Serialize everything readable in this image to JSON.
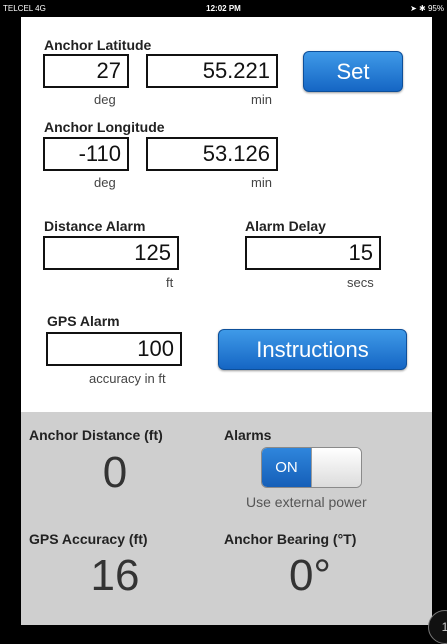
{
  "status_bar": {
    "carrier": "TELCEL  4G",
    "time": "12:02 PM",
    "battery": "95%"
  },
  "anchor_latitude": {
    "label": "Anchor Latitude",
    "degrees": "27",
    "minutes": "55.221",
    "deg_unit": "deg",
    "min_unit": "min"
  },
  "anchor_longitude": {
    "label": "Anchor Longitude",
    "degrees": "-110",
    "minutes": "53.126",
    "deg_unit": "deg",
    "min_unit": "min"
  },
  "set_button": {
    "label": "Set"
  },
  "distance_alarm": {
    "label": "Distance Alarm",
    "value": "125",
    "unit": "ft"
  },
  "alarm_delay": {
    "label": "Alarm Delay",
    "value": "15",
    "unit": "secs"
  },
  "gps_alarm": {
    "label": "GPS Alarm",
    "value": "100",
    "unit": "accuracy in ft"
  },
  "instructions_button": {
    "label": "Instructions"
  },
  "anchor_distance": {
    "label": "Anchor Distance (ft)",
    "value": "0"
  },
  "alarms": {
    "label": "Alarms",
    "toggle_text": "ON",
    "note": "Use external power"
  },
  "gps_accuracy": {
    "label": "GPS Accuracy (ft)",
    "value": "16"
  },
  "anchor_bearing": {
    "label": "Anchor Bearing (°T)",
    "value": "0°"
  },
  "corner_button": {
    "label": "1"
  }
}
